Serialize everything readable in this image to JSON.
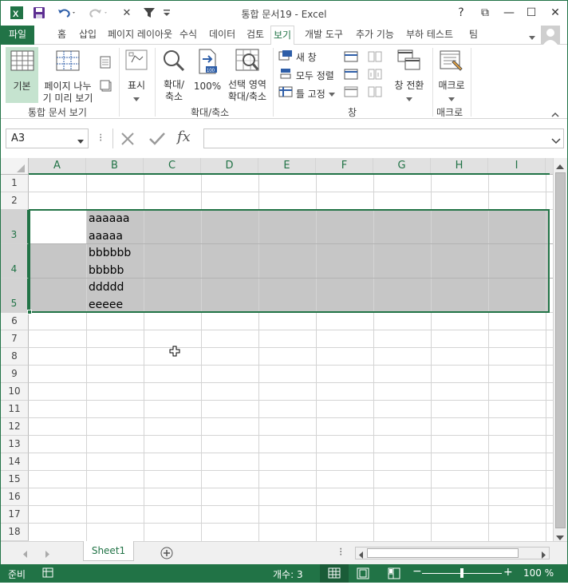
{
  "window": {
    "title": "통합 문서19 - Excel",
    "help_label": "?",
    "controls": {
      "ribbon_display": "⧉",
      "minimize": "—",
      "maximize": "☐",
      "close": "✕"
    }
  },
  "ribbon": {
    "file_tab": "파일",
    "tabs": [
      "홈",
      "삽입",
      "페이지 레이아웃",
      "수식",
      "데이터",
      "검토",
      "보기",
      "개발 도구",
      "추가 기능",
      "부하 테스트",
      "팀"
    ],
    "active_tab": "보기",
    "groups": {
      "workbook_views": {
        "label": "통합 문서 보기",
        "normal": "기본",
        "page_break_line1": "페이지 나누",
        "page_break_line2": "기 미리 보기"
      },
      "show": {
        "label": "표시"
      },
      "zoom": {
        "label": "확대/축소",
        "zoom_line1": "확대/",
        "zoom_line2": "축소",
        "hundred": "100%",
        "sel_line1": "선택 영역",
        "sel_line2": "확대/축소"
      },
      "window": {
        "label": "창",
        "new_window": "새 창",
        "arrange_all": "모두 정렬",
        "freeze_panes": "틀 고정",
        "switch_windows": "창 전환"
      },
      "macros": {
        "label": "매크로",
        "macros": "매크로"
      }
    }
  },
  "formula_bar": {
    "name_box": "A3",
    "fx": "fx",
    "content": ""
  },
  "grid": {
    "columns": [
      "A",
      "B",
      "C",
      "D",
      "E",
      "F",
      "G",
      "H",
      "I"
    ],
    "rows": [
      "1",
      "2",
      "3",
      "4",
      "5",
      "6",
      "7",
      "8",
      "9",
      "10",
      "11",
      "12",
      "13",
      "14",
      "15",
      "16",
      "17",
      "18"
    ],
    "selected_range": "A3:I5",
    "cells": {
      "B3_line1": "aaaaaa",
      "B3_line2": "aaaaa",
      "B4_line1": "bbbbbb",
      "B4_line2": "bbbbb",
      "B5_line1": "ddddd",
      "B5_line2": "eeeee"
    }
  },
  "sheets": {
    "tabs": [
      "Sheet1"
    ],
    "active": "Sheet1"
  },
  "status": {
    "ready": "준비",
    "count": "개수: 3",
    "zoom": "100 %",
    "colors": {
      "accent": "#217346",
      "selection": "#c6c6c6"
    }
  }
}
